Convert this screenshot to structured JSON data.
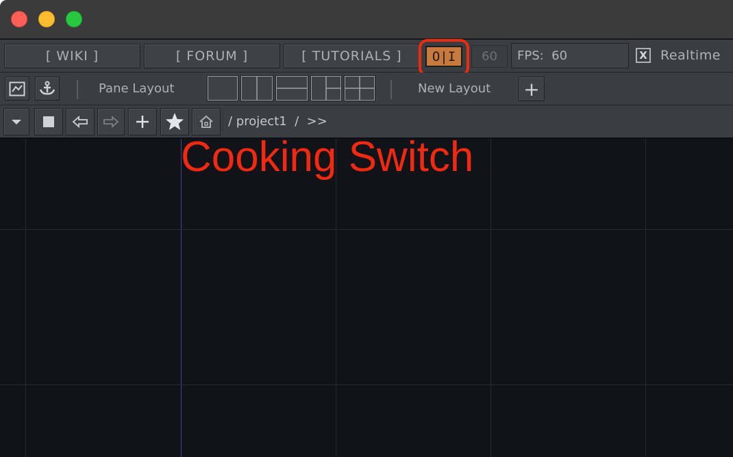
{
  "toolbar_top": {
    "wiki": "[ WIKI ]",
    "forum": "[ FORUM ]",
    "tutorials": "[ TUTORIALS ]",
    "cook_switch": "O|I",
    "fps_value": "60",
    "fps_label": "FPS:  60",
    "realtime_check": "X",
    "realtime_label": "Realtime"
  },
  "toolbar_layout": {
    "pane_layout_label": "Pane Layout",
    "new_layout_label": "New Layout",
    "add_label": "+"
  },
  "toolbar_nav": {
    "path": "/ project1  /  >>"
  },
  "annotation": {
    "text": "Cooking Switch",
    "color": "#f02a10"
  },
  "colors": {
    "cook_on": "#c77a3c",
    "highlight": "#ee2a10"
  },
  "icons": [
    "viewer-icon",
    "anchor-icon",
    "dropdown-arrow-icon",
    "stop-icon",
    "back-arrow-icon",
    "forward-arrow-icon",
    "plus-icon",
    "star-icon",
    "home-icon"
  ]
}
